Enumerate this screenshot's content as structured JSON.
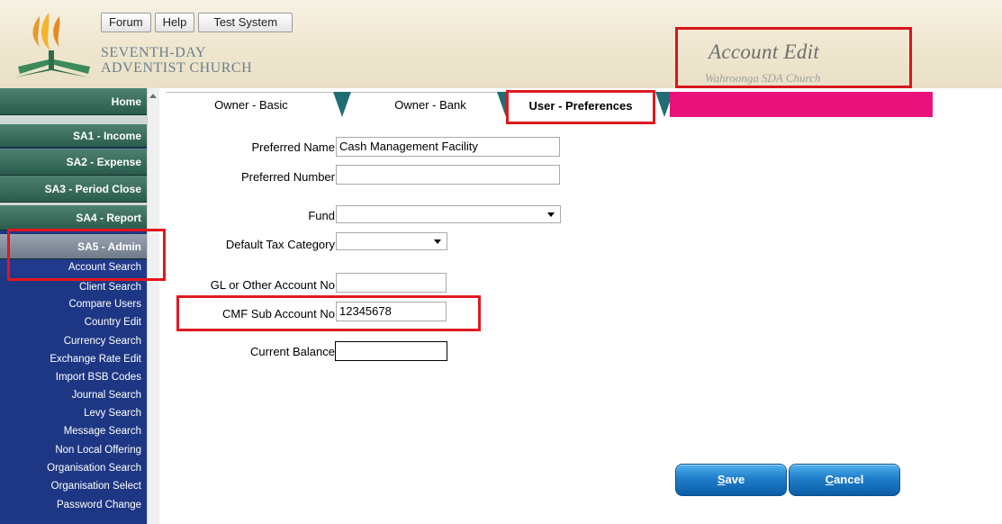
{
  "header": {
    "buttons": [
      "Forum",
      "Help",
      "Test System"
    ],
    "church_line1": "SEVENTH-DAY",
    "church_line2": "ADVENTIST CHURCH",
    "page_title": "Account Edit",
    "page_subtitle": "Wahroonga SDA Church"
  },
  "sidebar": {
    "sections": [
      "Home",
      "SA1 - Income",
      "SA2 - Expense",
      "SA3 - Period Close",
      "SA4 - Report",
      "SA5 - Admin"
    ],
    "admin_items": [
      "Account Search",
      "Client Search",
      "Compare Users",
      "Country Edit",
      "Currency Search",
      "Exchange Rate Edit",
      "Import BSB Codes",
      "Journal Search",
      "Levy Search",
      "Message Search",
      "Non Local Offering",
      "Organisation Search",
      "Organisation Select",
      "Password Change"
    ]
  },
  "tabs": {
    "items": [
      "Owner - Basic",
      "Owner - Bank",
      "User - Preferences"
    ],
    "active": "User - Preferences"
  },
  "form": {
    "preferred_name_label": "Preferred Name",
    "preferred_name_value": "Cash Management Facility",
    "preferred_number_label": "Preferred Number",
    "preferred_number_value": "",
    "fund_label": "Fund",
    "fund_value": "",
    "tax_label": "Default Tax Category",
    "tax_value": "",
    "gl_label": "GL or Other Account No",
    "gl_value": "",
    "cmf_label": "CMF Sub Account No",
    "cmf_value": "12345678",
    "balance_label": "Current Balance",
    "balance_value": ""
  },
  "actions": {
    "save_accel": "S",
    "save_rest": "ave",
    "cancel_accel": "C",
    "cancel_rest": "ancel"
  },
  "colors": {
    "sidebar_bg": "#1e3784",
    "section_green": "#3d6e5f",
    "highlight_red": "#e01a22",
    "tab_pink": "#e8127a",
    "button_blue": "#1f7fcb"
  }
}
